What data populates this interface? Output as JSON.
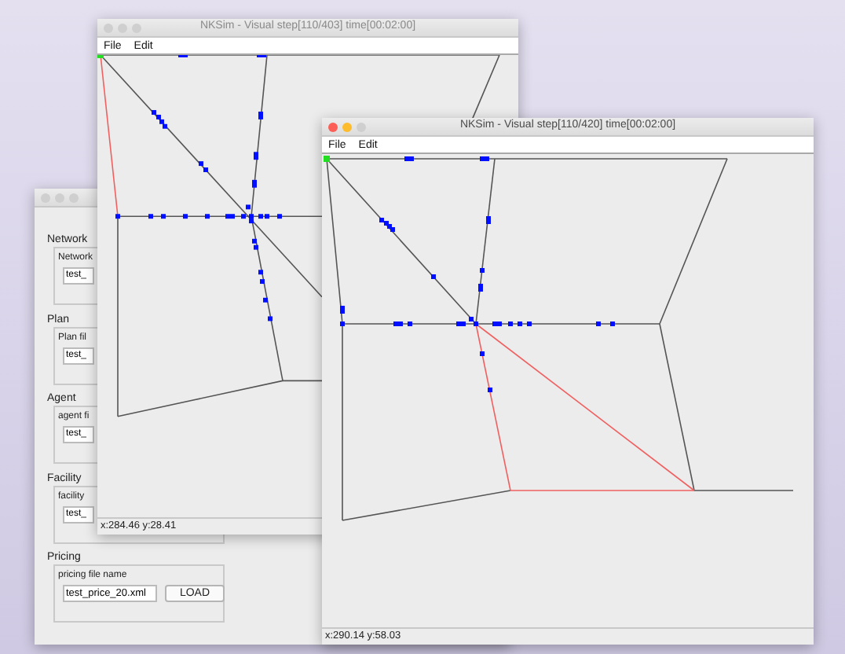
{
  "loader_window": {
    "active": false,
    "sections": [
      {
        "title": "Network",
        "label": "Network",
        "field_value": "test_"
      },
      {
        "title": "Plan",
        "label": "Plan fil",
        "field_value": "test_"
      },
      {
        "title": "Agent",
        "label": "agent fi",
        "field_value": "test_"
      },
      {
        "title": "Facility",
        "label": "facility",
        "field_value": "test_"
      },
      {
        "title": "Pricing",
        "label": "pricing file name",
        "field_value": "test_price_20.xml",
        "button": "LOAD"
      }
    ]
  },
  "sim_windows": [
    {
      "title": "NKSim - Visual step[110/403] time[00:02:00]",
      "active": false,
      "menu": [
        "File",
        "Edit"
      ],
      "status": "x:284.46 y:28.41"
    },
    {
      "title": "NKSim - Visual step[110/420] time[00:02:00]",
      "active": true,
      "menu": [
        "File",
        "Edit"
      ],
      "status": "x:290.14 y:58.03"
    }
  ]
}
